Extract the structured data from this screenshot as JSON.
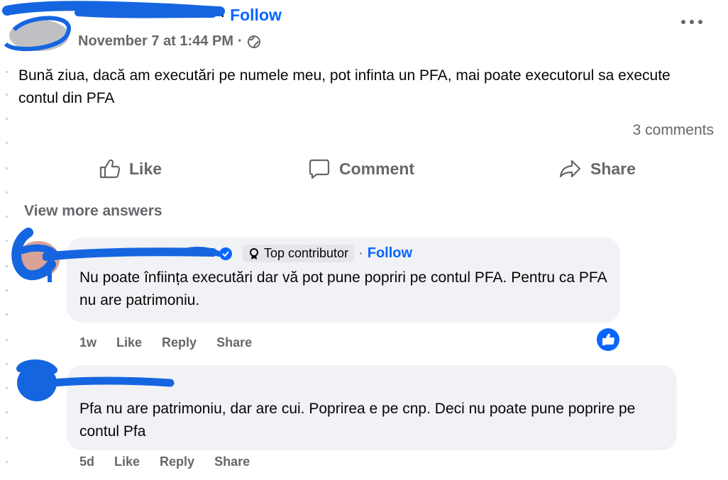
{
  "post": {
    "follow_label": "Follow",
    "separator": "·",
    "timestamp": "November 7 at 1:44 PM",
    "privacy_icon": "globe-icon",
    "more_icon": "more-options-icon",
    "text": "Bună ziua, dacă am executări pe numele meu, pot infinta un PFA, mai poate executorul sa execute contul din PFA",
    "comments_count": "3 comments"
  },
  "actions": {
    "like": "Like",
    "comment": "Comment",
    "share": "Share"
  },
  "view_more": "View more answers",
  "comments": [
    {
      "badge": "Top contributor",
      "follow": "Follow",
      "text": "Nu poate înființa executări dar vă pot pune popriri pe contul PFA. Pentru ca PFA nu are patrimoniu.",
      "time": "1w",
      "like": "Like",
      "reply": "Reply",
      "share": "Share",
      "reaction_icon": "like-reaction-icon"
    },
    {
      "text": "Pfa nu are patrimoniu, dar are cui. Poprirea e pe cnp. Deci nu poate pune poprire pe contul Pfa",
      "time": "5d",
      "like": "Like",
      "reply": "Reply",
      "share": "Share"
    }
  ],
  "colors": {
    "accent": "#0866ff",
    "secondary_text": "#65676b",
    "bubble": "#f0f2f5",
    "redaction": "#1565e0"
  }
}
